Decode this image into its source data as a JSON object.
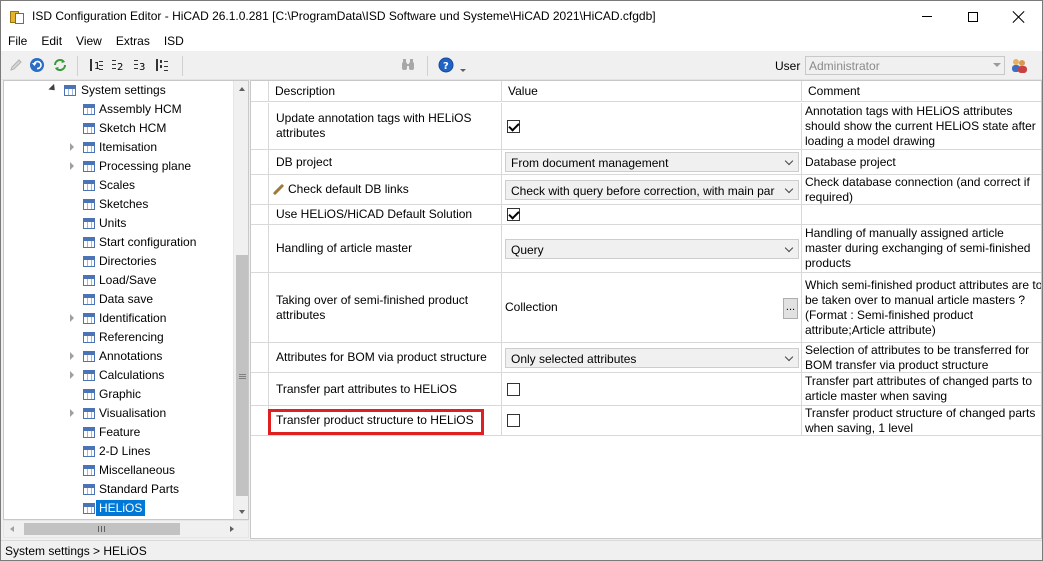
{
  "window": {
    "title": "ISD Configuration Editor  -  HiCAD 26.1.0.281 [C:\\ProgramData\\ISD Software und Systeme\\HiCAD 2021\\HiCAD.cfgdb]"
  },
  "menu": [
    "File",
    "Edit",
    "View",
    "Extras",
    "ISD"
  ],
  "toolbar": {
    "user_label": "User",
    "user_value": "Administrator"
  },
  "tree": {
    "root": "System settings",
    "items": [
      {
        "label": "Assembly HCM",
        "expandable": false
      },
      {
        "label": "Sketch HCM",
        "expandable": false
      },
      {
        "label": "Itemisation",
        "expandable": true
      },
      {
        "label": "Processing plane",
        "expandable": true
      },
      {
        "label": "Scales",
        "expandable": false
      },
      {
        "label": "Sketches",
        "expandable": false
      },
      {
        "label": "Units",
        "expandable": false
      },
      {
        "label": "Start configuration",
        "expandable": false
      },
      {
        "label": "Directories",
        "expandable": false
      },
      {
        "label": "Load/Save",
        "expandable": false
      },
      {
        "label": "Data save",
        "expandable": false
      },
      {
        "label": "Identification",
        "expandable": true
      },
      {
        "label": "Referencing",
        "expandable": false
      },
      {
        "label": "Annotations",
        "expandable": true
      },
      {
        "label": "Calculations",
        "expandable": true
      },
      {
        "label": "Graphic",
        "expandable": false
      },
      {
        "label": "Visualisation",
        "expandable": true
      },
      {
        "label": "Feature",
        "expandable": false
      },
      {
        "label": "2-D Lines",
        "expandable": false
      },
      {
        "label": "Miscellaneous",
        "expandable": false
      },
      {
        "label": "Standard Parts",
        "expandable": false
      },
      {
        "label": "HELiOS",
        "expandable": false,
        "selected": true
      }
    ]
  },
  "grid": {
    "headers": {
      "description": "Description",
      "value": "Value",
      "comment": "Comment"
    },
    "rows": [
      {
        "description": "Update annotation tags with HELiOS attributes",
        "type": "checkbox",
        "checked": true,
        "value": "",
        "comment": "Annotation tags with HELiOS attributes should show the current HELiOS state after loading a model drawing"
      },
      {
        "description": "DB project",
        "type": "combo",
        "value": "From document management",
        "comment": "Database project"
      },
      {
        "description": "Check default DB links",
        "type": "combo",
        "value": "Check with query before correction, with main par",
        "comment": "Check database connection (and correct if required)",
        "icon": "pencil-icon"
      },
      {
        "description": "Use HELiOS/HiCAD Default Solution",
        "type": "checkbox",
        "checked": true,
        "value": "",
        "comment": ""
      },
      {
        "description": "Handling of article master",
        "type": "combo",
        "value": "Query",
        "comment": "Handling of manually assigned article master during exchanging of semi-finished products"
      },
      {
        "description": "Taking over of semi-finished product attributes",
        "type": "text-button",
        "value": "Collection",
        "button": "...",
        "comment": "Which semi-finished product attributes are to be taken over to manual article masters ? (Format : Semi-finished product attribute;Article attribute)"
      },
      {
        "description": "Attributes for BOM via product structure",
        "type": "combo",
        "value": "Only selected attributes",
        "comment": "Selection of attributes to be transferred for BOM transfer via product structure"
      },
      {
        "description": "Transfer part attributes to HELiOS",
        "type": "checkbox",
        "checked": false,
        "value": "",
        "comment": "Transfer part attributes of changed parts to article master when saving"
      },
      {
        "description": "Transfer product structure to HELiOS",
        "type": "checkbox",
        "checked": false,
        "value": "",
        "comment": "Transfer product structure of changed parts when saving, 1 level",
        "highlighted": true
      }
    ]
  },
  "status": {
    "text": "System settings > HELiOS"
  },
  "colors": {
    "selection": "#0078d7",
    "highlight_border": "#e02020"
  }
}
